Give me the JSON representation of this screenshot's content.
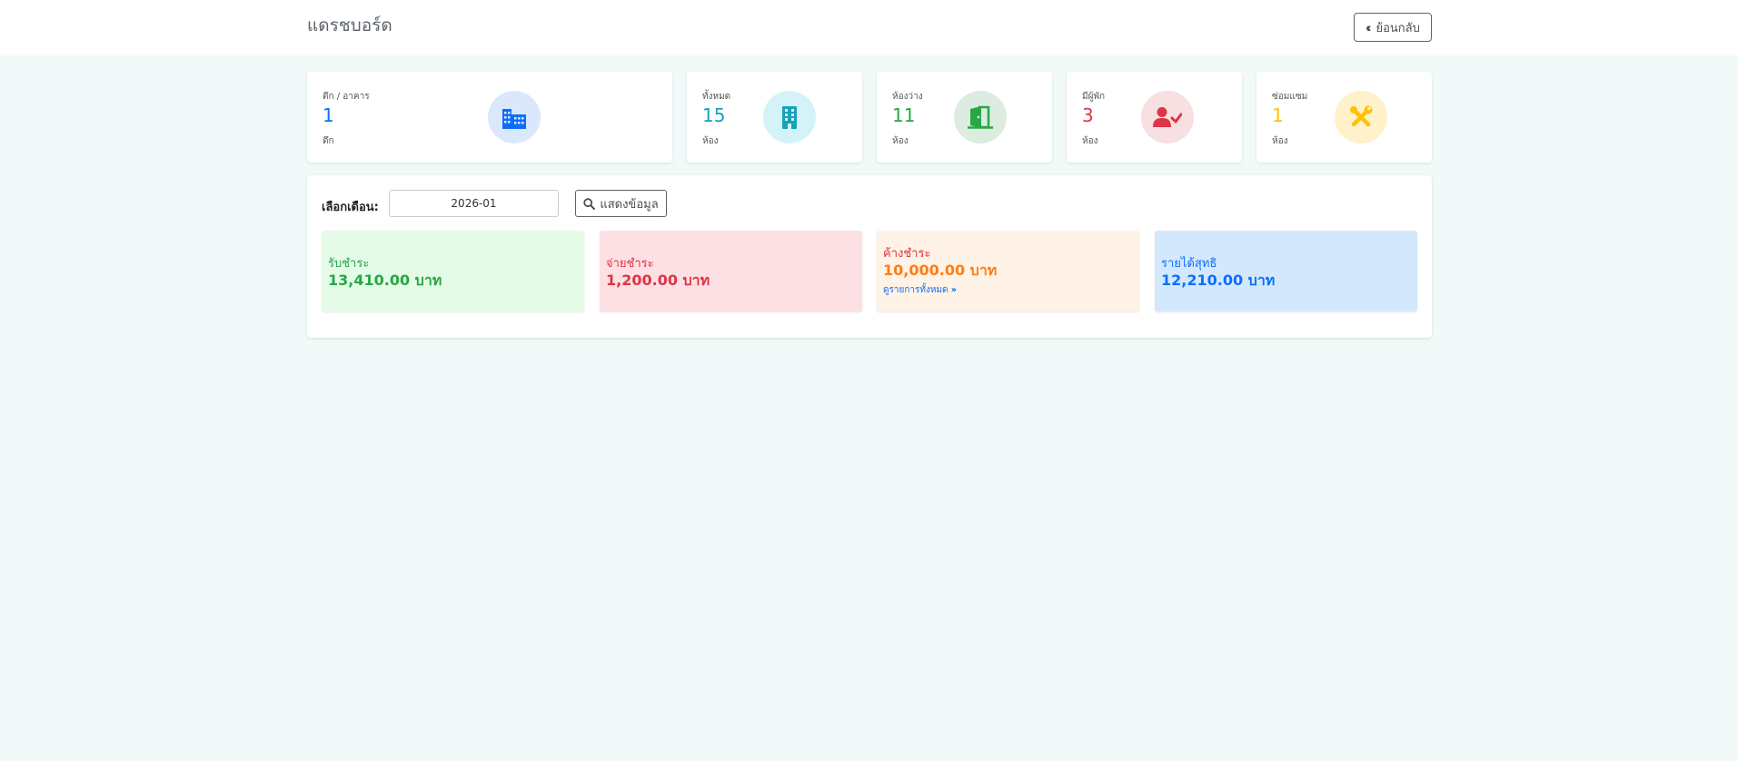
{
  "header": {
    "title": "แดรชบอร์ด",
    "back_label": "ย้อนกลับ",
    "back_icon": "double-chevron-left-icon"
  },
  "stats": [
    {
      "label": "ตึก / อาคาร",
      "value": "1",
      "unit": "ตึก",
      "color": "#0d6efd",
      "icon": "buildings-icon",
      "icon_bg": "#dbe8fb"
    },
    {
      "label": "ทั้งหมด",
      "value": "15",
      "unit": "ห้อง",
      "color": "#17a2b8",
      "icon": "building-icon",
      "icon_bg": "#d4f3f8"
    },
    {
      "label": "ห้องว่าง",
      "value": "11",
      "unit": "ห้อง",
      "color": "#28a745",
      "icon": "door-open-icon",
      "icon_bg": "#dcece1"
    },
    {
      "label": "มีผู้พัก",
      "value": "3",
      "unit": "ห้อง",
      "color": "#dc3545",
      "icon": "user-check-icon",
      "icon_bg": "#f8dfe1"
    },
    {
      "label": "ซ่อมแซม",
      "value": "1",
      "unit": "ห้อง",
      "color": "#ffc107",
      "icon": "tools-icon",
      "icon_bg": "#fff1c9"
    }
  ],
  "filter": {
    "label": "เลือกเดือน:",
    "month_value": "2026-01",
    "button_label": "แสดงข้อมูล",
    "button_icon": "search-icon"
  },
  "summary": [
    {
      "label": "รับชำระ",
      "value": "13,410.00 บาท",
      "color": "#28a745",
      "bg": "#e3fbe7"
    },
    {
      "label": "จ่ายชำระ",
      "value": "1,200.00 บาท",
      "color": "#dc3545",
      "bg": "#fde0e3"
    },
    {
      "label": "ค้างชำระ",
      "value": "10,000.00 บาท",
      "color": "#fd7e14",
      "bg": "#fff2e6",
      "label_color": "#dc3545",
      "link": "ดูรายการทั้งหมด"
    },
    {
      "label": "รายได้สุทธิ",
      "value": "12,210.00 บาท",
      "color": "#0d6efd",
      "bg": "#d3e8fd"
    }
  ]
}
